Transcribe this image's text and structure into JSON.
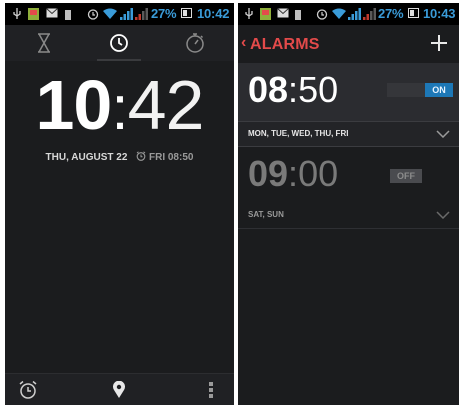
{
  "left_screen": {
    "status": {
      "battery_percent": "27%",
      "time": "10:42"
    },
    "tabs": [
      {
        "name": "timer",
        "icon": "hourglass-icon"
      },
      {
        "name": "clock",
        "icon": "clock-icon",
        "active": true
      },
      {
        "name": "stopwatch",
        "icon": "stopwatch-icon"
      }
    ],
    "clock": {
      "hours": "10",
      "separator": ":",
      "minutes": "42"
    },
    "date": "THU, AUGUST 22",
    "next_alarm": "FRI 08:50",
    "bottom_bar": {
      "alarm": "alarm-clock-icon",
      "cities": "location-pin-icon",
      "menu": "overflow-menu-icon"
    }
  },
  "right_screen": {
    "status": {
      "battery_percent": "27%",
      "time": "10:43"
    },
    "action_bar": {
      "back": "‹",
      "title": "ALARMS",
      "add": "plus-icon"
    },
    "alarms": [
      {
        "hours": "08",
        "separator": ":",
        "minutes": "50",
        "toggle": "ON",
        "enabled": true,
        "days": "MON, TUE, WED, THU, FRI"
      },
      {
        "hours": "09",
        "separator": ":",
        "minutes": "00",
        "toggle": "OFF",
        "enabled": false,
        "days": "SAT, SUN"
      }
    ]
  },
  "colors": {
    "accent_red": "#e24a4a",
    "toggle_blue": "#1d78b7",
    "status_blue": "#3a9bd8",
    "background": "#1b1c1e"
  }
}
